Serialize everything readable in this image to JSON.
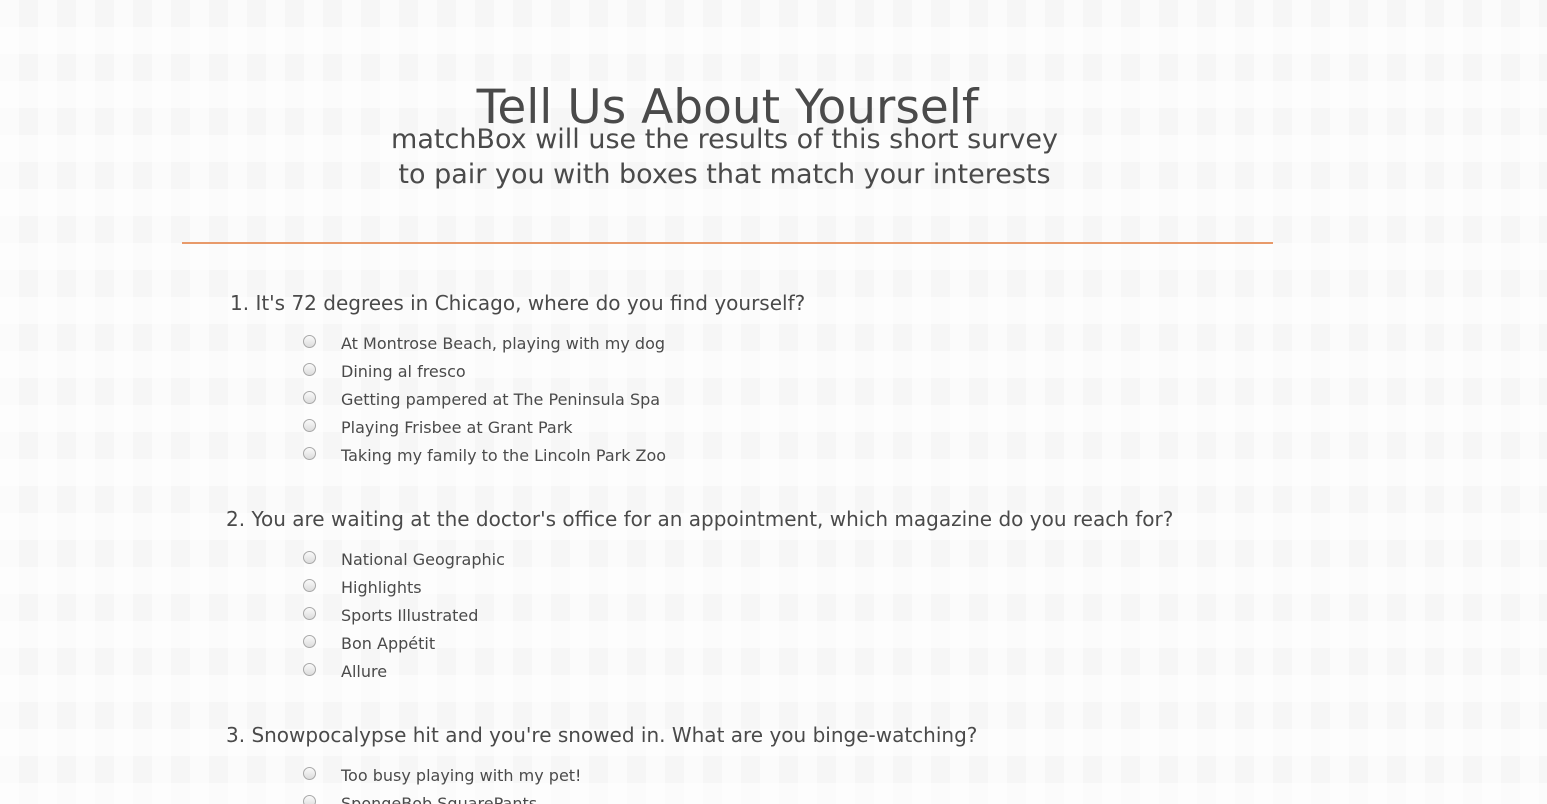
{
  "header": {
    "title": "Tell Us About Yourself",
    "subtitle_line1": "matchBox will use the results of this short survey",
    "subtitle_line2": "to pair you with boxes that match your interests"
  },
  "colors": {
    "divider": "#e89a6a",
    "text": "#4a4a4a"
  },
  "questions": [
    {
      "text": "1. It's 72 degrees in Chicago, where do you find yourself?",
      "options": [
        "At Montrose Beach, playing with my dog",
        "Dining al fresco",
        "Getting pampered at The Peninsula Spa",
        "Playing Frisbee at Grant Park",
        "Taking my family to the Lincoln Park Zoo"
      ]
    },
    {
      "text": "2. You are waiting at the doctor's office for an appointment, which magazine do you reach for?",
      "options": [
        "National Geographic",
        "Highlights",
        "Sports Illustrated",
        "Bon Appétit",
        "Allure"
      ]
    },
    {
      "text": "3. Snowpocalypse hit and you're snowed in. What are you binge-watching?",
      "options": [
        "Too busy playing with my pet!",
        "SpongeBob SquarePants"
      ]
    }
  ]
}
